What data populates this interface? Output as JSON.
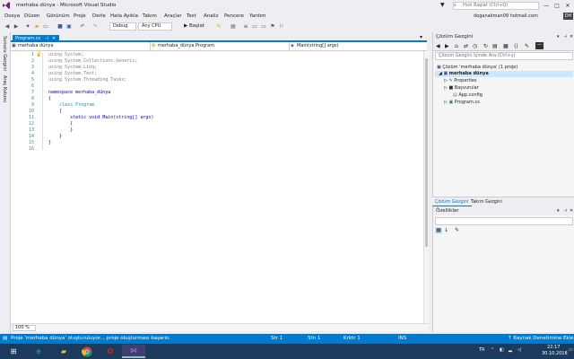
{
  "window": {
    "title": "merhaba dünya - Microsoft Visual Studio",
    "quick_launch_placeholder": "Hızlı Başlat (Ctrl+Q)",
    "user_email": "doganakman09 hotmail.com",
    "user_initials": "DH",
    "min": "—",
    "max": "□",
    "close": "✕"
  },
  "menu": [
    "Dosya",
    "Düzen",
    "Görünüm",
    "Proje",
    "Derle",
    "Hata Ayıkla",
    "Takım",
    "Araçlar",
    "Test",
    "Analiz",
    "Pencere",
    "Yardım"
  ],
  "toolbar": {
    "config": "Debug",
    "platform": "Any CPU",
    "start_label": "▶ Başlat"
  },
  "left_strip": {
    "server_explorer": "Sunucu Gezgini",
    "toolbox": "Araç Kutusu"
  },
  "editor": {
    "tab_label": "Program.cs",
    "nav": [
      "merhaba dünya",
      "merhaba_dünya.Program",
      "Main(string[] args)"
    ],
    "zoom": "100 %",
    "lines": [
      {
        "n": "1",
        "text": "using System;",
        "cls": "gr"
      },
      {
        "n": "2",
        "text": "using System.Collections.Generic;",
        "cls": "gr"
      },
      {
        "n": "3",
        "text": "using System.Linq;",
        "cls": "gr"
      },
      {
        "n": "4",
        "text": "using System.Text;",
        "cls": "gr"
      },
      {
        "n": "5",
        "text": "using System.Threading.Tasks;",
        "cls": "gr"
      },
      {
        "n": "6",
        "text": "",
        "cls": ""
      },
      {
        "n": "7",
        "text": "namespace merhaba_dünya",
        "cls": ""
      },
      {
        "n": "8",
        "text": "{",
        "cls": ""
      },
      {
        "n": "9",
        "text": "    class Program",
        "cls": ""
      },
      {
        "n": "10",
        "text": "    {",
        "cls": ""
      },
      {
        "n": "11",
        "text": "        static void Main(string[] args)",
        "cls": ""
      },
      {
        "n": "12",
        "text": "        {",
        "cls": ""
      },
      {
        "n": "13",
        "text": "        }",
        "cls": ""
      },
      {
        "n": "14",
        "text": "    }",
        "cls": ""
      },
      {
        "n": "15",
        "text": "}",
        "cls": ""
      },
      {
        "n": "16",
        "text": "",
        "cls": ""
      }
    ]
  },
  "solution_explorer": {
    "title": "Çözüm Gezgini",
    "search_placeholder": "Çözüm Gezgini İçinde Ara (Ctrl+ş)",
    "items": [
      {
        "label": "Çözüm 'merhaba dünya' (1 proje)",
        "indent": 0,
        "bold": false,
        "selected": false
      },
      {
        "label": "merhaba dünya",
        "indent": 1,
        "bold": true,
        "selected": true
      },
      {
        "label": "Properties",
        "indent": 2,
        "bold": false,
        "selected": false
      },
      {
        "label": "Başvurular",
        "indent": 2,
        "bold": false,
        "selected": false
      },
      {
        "label": "App.config",
        "indent": 2,
        "bold": false,
        "selected": false
      },
      {
        "label": "Program.cs",
        "indent": 2,
        "bold": false,
        "selected": false
      }
    ],
    "tabs": [
      "Çözüm Gezgini",
      "Takım Gezgini"
    ]
  },
  "properties": {
    "title": "Özellikler"
  },
  "status": {
    "message": "Proje 'merhaba dünya' oluşturuluyor... proje oluşturması başarılı.",
    "line": "Str 1",
    "col": "Stn 1",
    "ch": "Krktr 1",
    "ins": "INS",
    "source_control": "↑ Kaynak Denetimine Ekle ▲"
  },
  "taskbar": {
    "lang": "TR",
    "time": "22:17",
    "date": "30.10.2018"
  },
  "colors": {
    "accent": "#007acc",
    "taskbar": "#1b3a5c"
  }
}
